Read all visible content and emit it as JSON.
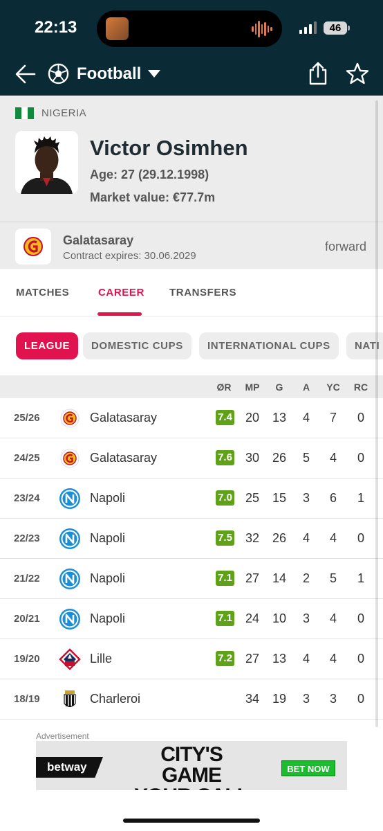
{
  "status_bar": {
    "time": "22:13",
    "battery": "46"
  },
  "nav": {
    "title": "Football"
  },
  "player": {
    "country": "NIGERIA",
    "name": "Victor Osimhen",
    "age": "Age: 27 (29.12.1998)",
    "market_value": "Market value: €77.7m",
    "club": "Galatasaray",
    "contract": "Contract expires: 30.06.2029",
    "position": "forward"
  },
  "tabs": [
    "MATCHES",
    "CAREER",
    "TRANSFERS"
  ],
  "active_tab": "CAREER",
  "chips": [
    "LEAGUE",
    "DOMESTIC CUPS",
    "INTERNATIONAL CUPS",
    "NATI"
  ],
  "table": {
    "headers": [
      "ØR",
      "MP",
      "G",
      "A",
      "YC",
      "RC"
    ],
    "rows": [
      {
        "season": "25/26",
        "team": "Galatasaray",
        "logo": "galatasaray-logo",
        "rating": "7.4",
        "mp": "20",
        "g": "13",
        "a": "4",
        "yc": "7",
        "rc": "0"
      },
      {
        "season": "24/25",
        "team": "Galatasaray",
        "logo": "galatasaray-logo",
        "rating": "7.6",
        "mp": "30",
        "g": "26",
        "a": "5",
        "yc": "4",
        "rc": "0"
      },
      {
        "season": "23/24",
        "team": "Napoli",
        "logo": "napoli-logo",
        "rating": "7.0",
        "mp": "25",
        "g": "15",
        "a": "3",
        "yc": "6",
        "rc": "1"
      },
      {
        "season": "22/23",
        "team": "Napoli",
        "logo": "napoli-logo",
        "rating": "7.5",
        "mp": "32",
        "g": "26",
        "a": "4",
        "yc": "4",
        "rc": "0"
      },
      {
        "season": "21/22",
        "team": "Napoli",
        "logo": "napoli-logo",
        "rating": "7.1",
        "mp": "27",
        "g": "14",
        "a": "2",
        "yc": "5",
        "rc": "1"
      },
      {
        "season": "20/21",
        "team": "Napoli",
        "logo": "napoli-logo",
        "rating": "7.1",
        "mp": "24",
        "g": "10",
        "a": "3",
        "yc": "4",
        "rc": "0"
      },
      {
        "season": "19/20",
        "team": "Lille",
        "logo": "lille-logo",
        "rating": "7.2",
        "mp": "27",
        "g": "13",
        "a": "4",
        "yc": "4",
        "rc": "0"
      },
      {
        "season": "18/19",
        "team": "Charleroi",
        "logo": "charleroi-logo",
        "rating": "",
        "mp": "34",
        "g": "19",
        "a": "3",
        "yc": "3",
        "rc": "0"
      }
    ]
  },
  "ad": {
    "label": "Advertisement",
    "brand": "betway",
    "headline": "CITY'S GAME YOUR CALL",
    "cta": "BET NOW"
  },
  "colors": {
    "nav_bg": "#0a2a35",
    "accent": "#e0134f",
    "rating_bg": "#5fa21a",
    "napoli_blue": "#1a8fd6",
    "galatasaray_red": "#c8102e",
    "galatasaray_yellow": "#f2b81c"
  }
}
